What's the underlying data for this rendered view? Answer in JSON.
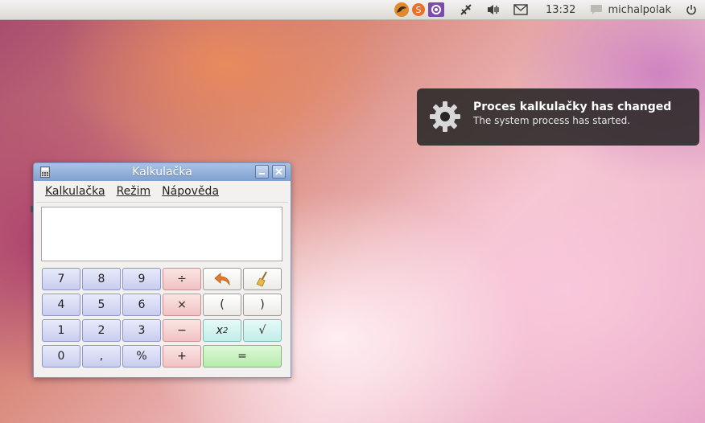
{
  "topbar": {
    "clock": "13:32",
    "user": "michalpolak",
    "tray_icons": [
      "gimp-icon",
      "sync-icon",
      "settings-icon",
      "network-icon",
      "volume-icon",
      "mail-icon",
      "chat-icon",
      "power-icon"
    ]
  },
  "notification": {
    "title": "Proces kalkulačky has changed",
    "body": "The system process has started.",
    "icon": "gear-icon"
  },
  "calculator": {
    "title": "Kalkulačka",
    "menu": [
      "Kalkulačka",
      "Režim",
      "Nápověda"
    ],
    "display_value": "",
    "keys": {
      "k7": "7",
      "k8": "8",
      "k9": "9",
      "div": "÷",
      "k4": "4",
      "k5": "5",
      "k6": "6",
      "mul": "×",
      "lpar": "(",
      "rpar": ")",
      "k1": "1",
      "k2": "2",
      "k3": "3",
      "sub": "−",
      "sqrt": "√",
      "k0": "0",
      "comma": ",",
      "pct": "%",
      "add": "+",
      "eq": "="
    },
    "square_key": {
      "base": "x",
      "exp": "2"
    }
  },
  "colors": {
    "notification_bg": "#282626",
    "titlebar": "#7fa0d0",
    "number_key": "#c8cdee",
    "operator_key": "#f0c2c2",
    "function_key": "#c2ede9",
    "equals_key": "#b6ecac"
  }
}
